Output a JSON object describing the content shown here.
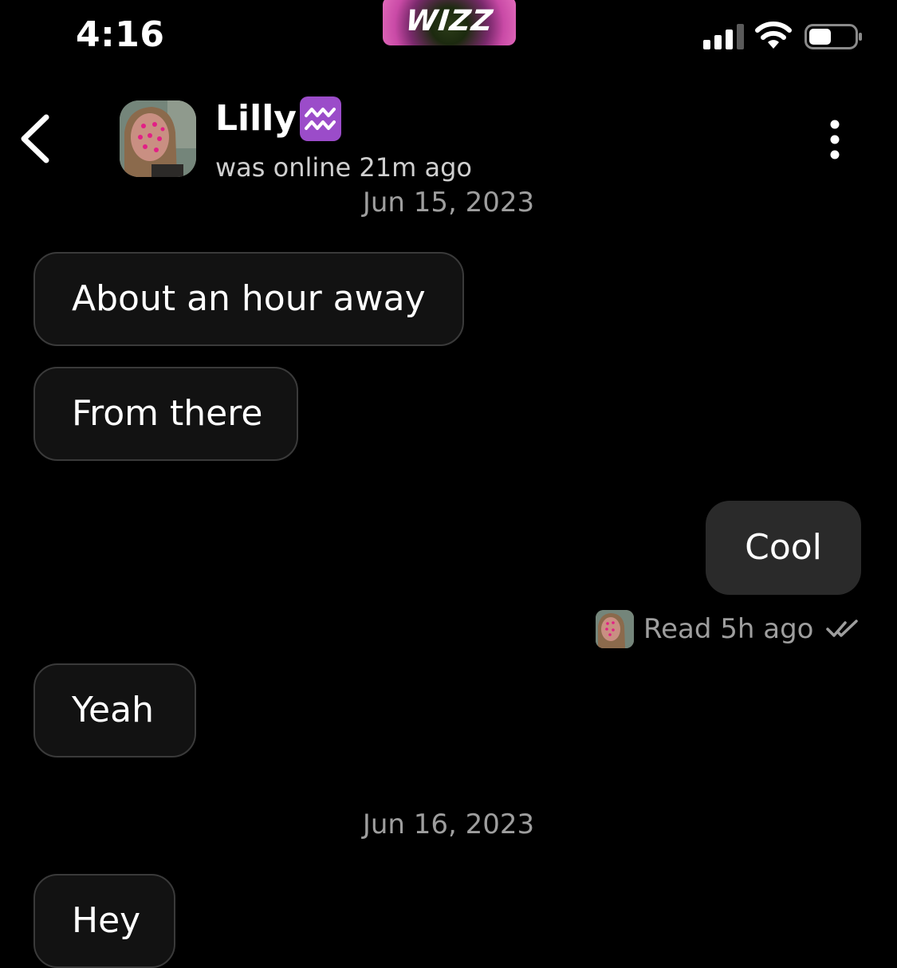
{
  "status_bar": {
    "time": "4:16",
    "brand": "WIZZ"
  },
  "header": {
    "contact_name": "Lilly",
    "zodiac_symbol": "♒",
    "status": "was online 21m ago"
  },
  "messages": [
    {
      "type": "date",
      "text": "Jun 15, 2023"
    },
    {
      "type": "incoming",
      "text": "About an hour away"
    },
    {
      "type": "incoming",
      "text": "From there"
    },
    {
      "type": "outgoing",
      "text": "Cool"
    },
    {
      "type": "receipt",
      "text": "Read 5h ago"
    },
    {
      "type": "incoming",
      "text": "Yeah"
    },
    {
      "type": "date",
      "text": "Jun 16, 2023"
    },
    {
      "type": "incoming",
      "text": "Hey"
    }
  ],
  "colors": {
    "background": "#000000",
    "incoming_bubble": "#121212",
    "incoming_border": "#3a3a3a",
    "outgoing_bubble": "#2a2a2a",
    "muted_text": "#9e9e9e"
  }
}
